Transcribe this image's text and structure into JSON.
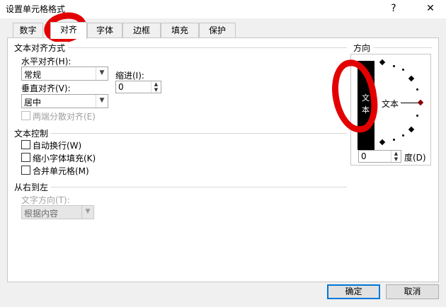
{
  "window": {
    "title": "设置单元格格式",
    "help_glyph": "?",
    "close_glyph": "✕"
  },
  "tabs": [
    {
      "label": "数字"
    },
    {
      "label": "对齐"
    },
    {
      "label": "字体"
    },
    {
      "label": "边框"
    },
    {
      "label": "填充"
    },
    {
      "label": "保护"
    }
  ],
  "active_tab": "对齐",
  "text_alignment": {
    "group_label": "文本对齐方式",
    "horizontal_label": "水平对齐(H):",
    "horizontal_value": "常规",
    "indent_label": "缩进(I):",
    "indent_value": "0",
    "vertical_label": "垂直对齐(V):",
    "vertical_value": "居中",
    "distributed_label": "两端分散对齐(E)"
  },
  "text_control": {
    "group_label": "文本控制",
    "wrap_label": "自动换行(W)",
    "shrink_label": "缩小字体填充(K)",
    "merge_label": "合并单元格(M)"
  },
  "rtl": {
    "group_label": "从右到左",
    "direction_label": "文字方向(T):",
    "direction_value": "根据内容"
  },
  "orientation": {
    "group_label": "方向",
    "vertical_text": [
      "文",
      "本"
    ],
    "dial_text": "文本",
    "degree_value": "0",
    "degree_label": "度(D)"
  },
  "footer": {
    "ok_label": "确定",
    "cancel_label": "取消"
  },
  "colors": {
    "annotation_red": "#e30000",
    "default_button_border": "#0078d7"
  },
  "icons": [
    "help-icon",
    "close-icon",
    "chevron-down-icon",
    "spin-up-icon",
    "spin-down-icon"
  ]
}
